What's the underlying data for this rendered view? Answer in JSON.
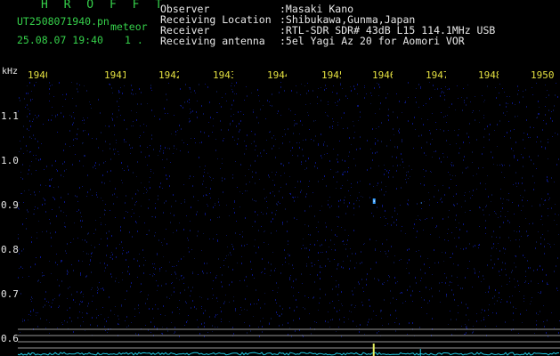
{
  "header": {
    "title": "H R O F F T",
    "filename": "UT2508071940.pn",
    "mode": "meteor",
    "datetime": "25.08.07 19:40",
    "count": "1 .",
    "info_labels": [
      "Observer",
      "Receiving Location",
      "Receiver",
      "Receiving antenna"
    ],
    "info_values": [
      ":Masaki Kano",
      ":Shibukawa,Gunma,Japan",
      ":RTL-SDR SDR# 43dB L15 114.1MHz USB",
      ":5el Yagi Az 20 for Aomori VOR"
    ]
  },
  "axes": {
    "y_unit": "kHz",
    "x_ticks": [
      "1940",
      "1941",
      "1942",
      "1943",
      "1944",
      "1945",
      "1946",
      "1947",
      "1948",
      "1949",
      "1950"
    ],
    "y_ticks": [
      "1.1",
      "1.0",
      "0.9",
      "0.8",
      "0.7",
      "0.6"
    ]
  },
  "colors": {
    "background": "#000000",
    "header_text": "#35d04a",
    "info_text": "#e8e8e8",
    "tick_text": "#e4e040",
    "spectrum": "#20c8e0",
    "echo": "#e6f060",
    "reference_lines": "#c8c8c8"
  },
  "signals": {
    "echo_minute": 1946.6,
    "echo_freq_khz": 0.91
  }
}
